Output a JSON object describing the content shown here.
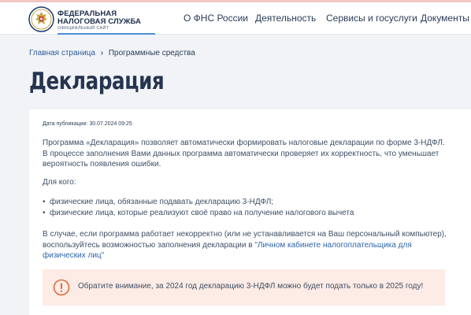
{
  "header": {
    "logo_line1": "ФЕДЕРАЛЬНАЯ",
    "logo_line2": "НАЛОГОВАЯ СЛУЖБА",
    "logo_subtitle": "ОФИЦИАЛЬНЫЙ САЙТ",
    "nav": [
      "О ФНС России",
      "Деятельность",
      "Сервисы и госуслуги",
      "Документы"
    ]
  },
  "breadcrumb": {
    "home": "Главная страница",
    "current": "Программные средства"
  },
  "page_title": "Декларация",
  "article": {
    "pub_date": "Дата публикации: 30.07.2024 09:25",
    "intro": "Программа «Декларация» позволяет автоматически формировать налоговые декларации по форме 3-НДФЛ. В процессе заполнения Вами данных программа автоматически проверяет их корректность, что уменьшает вероятность появления ошибки.",
    "for_whom": "Для кого:",
    "audience": [
      "физические лица, обязанные подавать декларацию 3-НДФЛ;",
      "физические лица, которые реализуют своё право на получение налогового вычета"
    ],
    "problem_text": "В случае, если программа работает некорректно (или не устанавливается на Ваш персональный компьютер), воспользуйтесь возможностью заполнения декларации в ",
    "problem_link": "\"Личном кабинете налогоплательщика для физических лиц\"",
    "notice": "Обратите внимание, за 2024 год декларацию 3-НДФЛ можно будет подать только в 2025 году!"
  },
  "colors": {
    "page_bg": "#f1f3f7",
    "notice_bg": "#fdebe5",
    "notice_accent": "#e06a3c",
    "link": "#2d64a8",
    "top_accent": "#f0c7c2"
  },
  "icons": {
    "logo": "fns-emblem-icon",
    "notice": "info-circle-icon",
    "breadcrumb_sep": "chevron-right-icon"
  }
}
